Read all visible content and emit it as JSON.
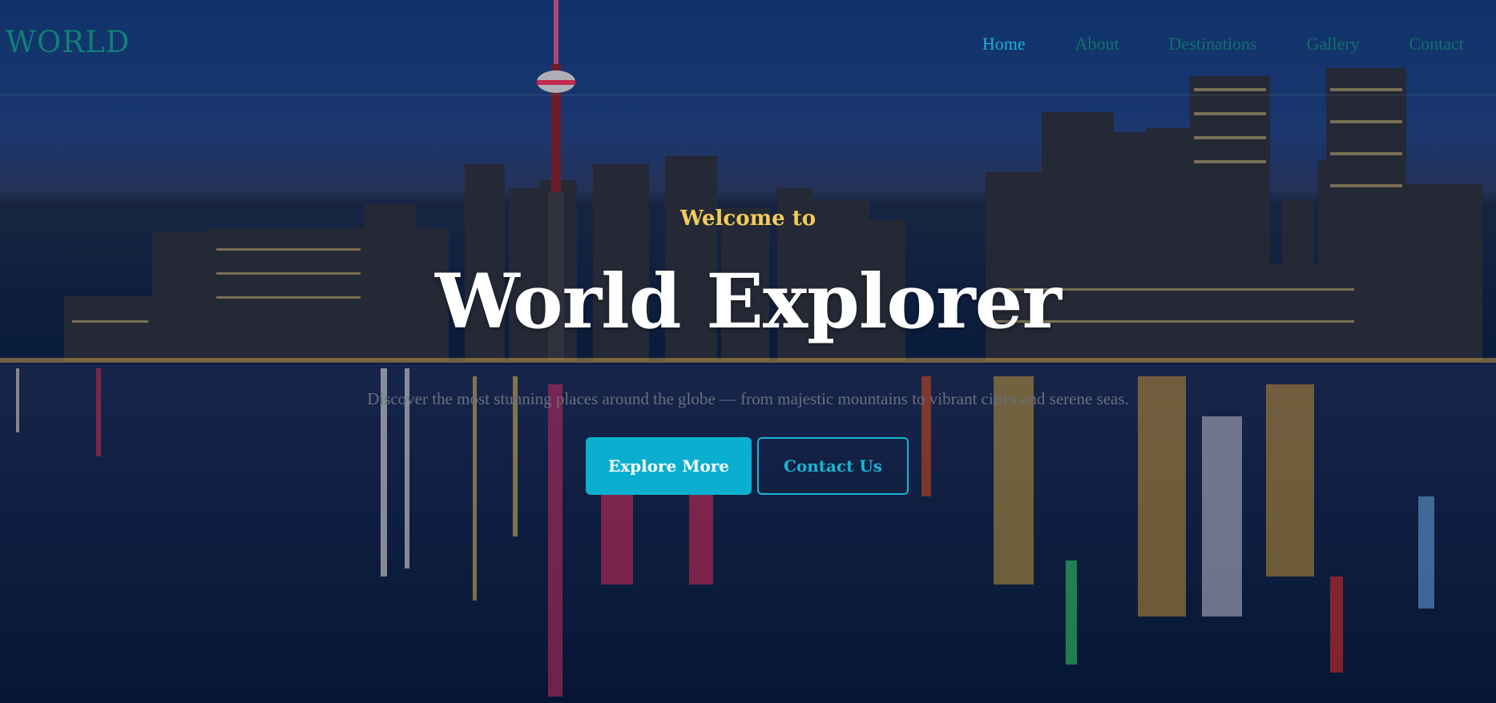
{
  "nav": {
    "logo": "WORLD",
    "items": [
      {
        "label": "Home",
        "active": true
      },
      {
        "label": "About",
        "active": false
      },
      {
        "label": "Destinations",
        "active": false
      },
      {
        "label": "Gallery",
        "active": false
      },
      {
        "label": "Contact",
        "active": false
      }
    ]
  },
  "hero": {
    "welcome": "Welcome to",
    "title": "World Explorer",
    "subtitle": "Discover the most stunning places around the globe — from majestic mountains to vibrant cities and serene seas.",
    "primary_button": "Explore More",
    "secondary_button": "Contact Us"
  },
  "colors": {
    "accent": "#0aafd0",
    "welcome": "#f2cc5a",
    "logo": "#0f7f78"
  },
  "icons": []
}
